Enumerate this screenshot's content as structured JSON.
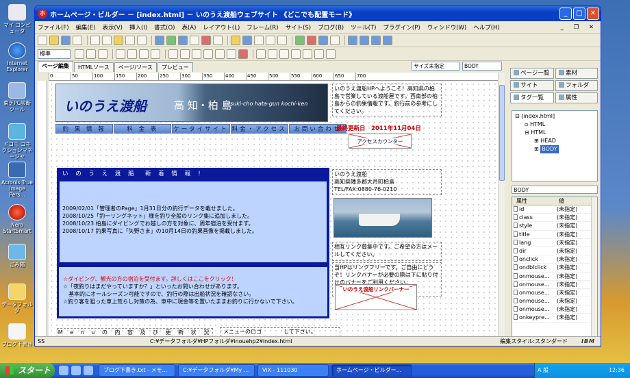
{
  "desktop_icons": [
    {
      "label": "マイ コンピュータ"
    },
    {
      "label": "Internet Explorer"
    },
    {
      "label": "東芝PC診断ツール"
    },
    {
      "label": "ドコモ コネクションマネージャ"
    },
    {
      "label": "Acronis True Image Pers..."
    },
    {
      "label": "Nero StartSmart"
    },
    {
      "label": "ごみ箱"
    },
    {
      "label": "データフォルダ"
    },
    {
      "label": "ブログ下書き"
    }
  ],
  "window": {
    "title": "ホームページ・ビルダー － [index.html] － いのうえ渡船ウェブサイト 《どこでも配置モード》",
    "menu": [
      "ファイル(F)",
      "編集(E)",
      "表示(V)",
      "挿入(I)",
      "書式(O)",
      "表(A)",
      "レイアウト(L)",
      "フレーム(R)",
      "サイト(S)",
      "ブログ(B)",
      "ツール(T)",
      "プラグイン(P)",
      "ウィンドウ(W)",
      "ヘルプ(H)"
    ],
    "format_select": "標準",
    "tabs": [
      "ページ編集",
      "HTMLソース",
      "ページ/ソース",
      "プレビュー"
    ],
    "size_select": "サイズ未指定",
    "tag_select": "BODY",
    "ruler": [
      "0",
      "50",
      "100",
      "150",
      "200",
      "250",
      "300",
      "350",
      "400",
      "450",
      "500",
      "550",
      "600",
      "650",
      "700"
    ]
  },
  "page": {
    "banner_title": "いのうえ渡船",
    "banner_location": "高 知・柏 島",
    "banner_roman": "otsuki-cho hata-gun kochi-ken",
    "nav": [
      "釣 果 情 報",
      "料 金 表",
      "ケータイサイト",
      "料金・アクセス",
      "お問い合わせ"
    ],
    "intro": "いのうえ渡船HPへようこそ！高知県の柏島で営業している渡船屋です。西南部の柏島からの釣果情報です。釣行前の参考にしてください。",
    "updated_label": "最終更新日",
    "updated_date": "2011年11月04日",
    "counter_label": "アクセスカウンター",
    "news_heading": "い の う え 渡 船　新 着 情 報 ！",
    "news": [
      "2009/02/01「管理者のPage」1月31日分の釣行データを載せました。",
      "2008/10/25「釣ーリングネット」様を釣り全般のリンク集に追加しました。",
      "2008/10/23 柏島にダイビングでお越しの方を対象に、周年宿泊を受付ます。",
      "2008/10/17 釣果写真に「矢野さま」の10月14日の釣果画像を掲載しました。"
    ],
    "info_red": "☆ダイビング、観光の方の宿泊を受付ます。詳しくはここをクリック！",
    "info": [
      "☆「夜釣りはまだやっていますか？」といったお問い合わせがあります。",
      "　基本的にオールシーズン可能ですので、釣行の際は出船状況を確認なさい。",
      "☆釣り客を狙った車上荒らし対策の為、車中に現金等を置いたままお釣りに行かないで下さい。"
    ],
    "address": [
      "いのうえ渡船",
      "高知県幡多郡大月町柏島",
      "TEL/FAX:0880-76-0210"
    ],
    "link_recruit": "相互リンク募集中です。ご希望の方はメールしてください。",
    "link_free": "当HPはリンクフリーです。ご自由にどうぞ！リンクバナーが必要の際は下に貼り付けのバナーをご利用ください。",
    "link_banner": "いのうえ渡船リンクバーナー",
    "menu_note": "M e n u の 内 容 及 び 更 新 状 況",
    "logo_note": "メニューのロゴ　　　　して下さい。"
  },
  "status": {
    "left": "SS",
    "path": "C:¥データフォルダ¥HPフォルダ¥inouehp2¥index.html",
    "mode": "編集スタイル:スタンダード",
    "brand": "IBM"
  },
  "right_panel": {
    "tabs": [
      "ページ一覧",
      "素材",
      "サイト",
      "フォルダ",
      "タグ一覧",
      "属性"
    ],
    "tree": [
      "[index.html]",
      "HTML",
      "HTML",
      "HEAD",
      "BODY"
    ],
    "element": "BODY",
    "prop_header": [
      "属性",
      "値"
    ],
    "props": [
      {
        "k": "id",
        "v": "(未指定)"
      },
      {
        "k": "class",
        "v": "(未指定)"
      },
      {
        "k": "style",
        "v": "(未指定)"
      },
      {
        "k": "title",
        "v": "(未指定)"
      },
      {
        "k": "lang",
        "v": "(未指定)"
      },
      {
        "k": "dir",
        "v": "(未指定)"
      },
      {
        "k": "onclick",
        "v": "(未指定)"
      },
      {
        "k": "ondblclick",
        "v": "(未指定)"
      },
      {
        "k": "onmouse...",
        "v": "(未指定)"
      },
      {
        "k": "onmouse...",
        "v": "(未指定)"
      },
      {
        "k": "onmouse...",
        "v": "(未指定)"
      },
      {
        "k": "onmouse...",
        "v": "(未指定)"
      },
      {
        "k": "onmouse...",
        "v": "(未指定)"
      },
      {
        "k": "onkeypre...",
        "v": "(未指定)"
      }
    ]
  },
  "taskbar": {
    "start": "スタート",
    "tasks": [
      "ブログ下書き.txt - メモ...",
      "C:¥データフォルダ¥My ...",
      "ViX - 111030",
      "ホームページ・ビルダー..."
    ],
    "clock": "12:36",
    "ime": "A 般"
  }
}
